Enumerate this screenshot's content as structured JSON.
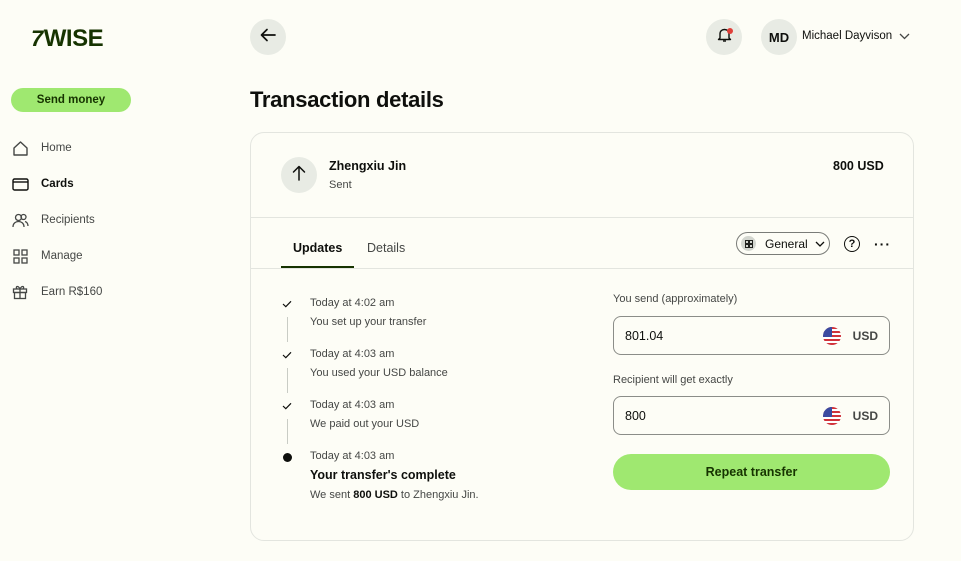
{
  "brand": {
    "logo_text": "WISE",
    "logo_flag": "7"
  },
  "sidebar": {
    "send_label": "Send money",
    "items": [
      {
        "label": "Home",
        "icon": "home-icon"
      },
      {
        "label": "Cards",
        "icon": "card-icon",
        "active": true
      },
      {
        "label": "Recipients",
        "icon": "recipients-icon"
      },
      {
        "label": "Manage",
        "icon": "grid-icon"
      },
      {
        "label": "Earn R$160",
        "icon": "gift-icon"
      }
    ]
  },
  "header": {
    "avatar_initials": "MD",
    "user_name": "Michael Dayvison",
    "page_title": "Transaction details"
  },
  "transaction": {
    "name": "Zhengxiu Jin",
    "status": "Sent",
    "amount": "800 USD"
  },
  "tabs": [
    {
      "label": "Updates",
      "active": true
    },
    {
      "label": "Details",
      "active": false
    }
  ],
  "toolbar": {
    "category_label": "General",
    "help_glyph": "?",
    "more_glyph": "···"
  },
  "timeline": [
    {
      "time": "Today at 4:02 am",
      "text": "You set up your transfer"
    },
    {
      "time": "Today at 4:03 am",
      "text": "You used your USD balance"
    },
    {
      "time": "Today at 4:03 am",
      "text": "We paid out your USD"
    },
    {
      "time": "Today at 4:03 am",
      "text": "Your transfer's complete",
      "sentence_prefix": "We sent ",
      "sentence_amount": "800 USD",
      "sentence_suffix": " to Zhengxiu Jin."
    }
  ],
  "form": {
    "send_label": "You send (approximately)",
    "send_value": "801.04",
    "send_currency": "USD",
    "receive_label": "Recipient will get exactly",
    "receive_value": "800",
    "receive_currency": "USD",
    "repeat_label": "Repeat transfer"
  },
  "colors": {
    "accent": "#9fe870",
    "brand_dark": "#163300",
    "background": "#fdfdf6"
  }
}
